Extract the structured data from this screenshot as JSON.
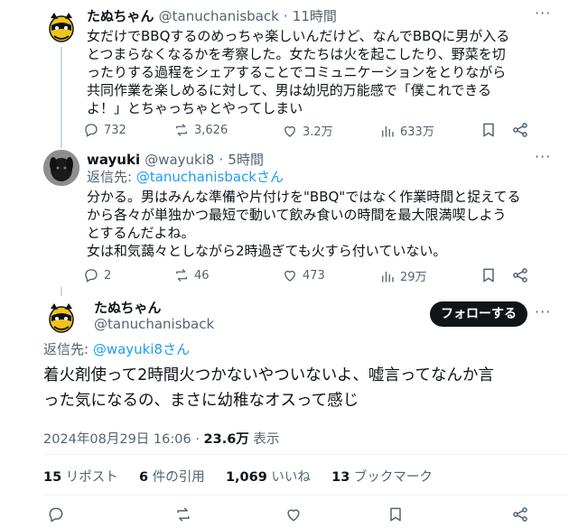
{
  "tweet1": {
    "name": "たぬちゃん",
    "handle": "@tanuchanisback",
    "time": "11時間",
    "lines": [
      "女だけでBBQするのめっちゃ楽しいんだけど、なんでBBQに男が入る",
      "とつまらなくなるかを考察した。女たちは火を起こしたり、野菜を切",
      "ったりする過程をシェアすることでコミュニケーションをとりながら",
      "共同作業を楽しめるに対して、男は幼児的万能感で「僕これできる",
      "よ！」とちゃっちゃとやってしまい"
    ],
    "replies": "732",
    "reposts": "3,626",
    "likes": "3.2万",
    "views": "633万"
  },
  "tweet2": {
    "name": "wayuki",
    "handle": "@wayuki8",
    "time": "5時間",
    "reply_prefix": "返信先: ",
    "reply_to": "@tanuchanisbackさん",
    "lines": [
      "分かる。男はみんな準備や片付けを\"BBQ\"ではなく作業時間と捉えてる",
      "から各々が単独かつ最短で動いて飲み食いの時間を最大限満喫しよう",
      "とするんだよね。",
      "女は和気藹々としながら2時過ぎても火すら付いていない。"
    ],
    "replies": "2",
    "reposts": "46",
    "likes": "473",
    "views": "29万"
  },
  "main": {
    "name": "たぬちゃん",
    "handle": "@tanuchanisback",
    "follow_label": "フォローする",
    "reply_prefix": "返信先: ",
    "reply_to": "@wayuki8さん",
    "lines": [
      "着火剤使って2時間火つかないやついないよ、嘘言ってなんか言",
      "った気になるの、まさに幼稚なオスって感じ"
    ],
    "timestamp": "2024年08月29日 16:06",
    "views_count": "23.6万",
    "views_label": " 表示",
    "reposts_count": "15",
    "reposts_label": " リポスト",
    "quotes_count": "6",
    "quotes_label": " 件の引用",
    "likes_count": "1,069",
    "likes_label": " いいね",
    "bookmarks_count": "13",
    "bookmarks_label": " ブックマーク"
  },
  "colors": {
    "link": "#1d9bf0",
    "muted": "#536471",
    "text": "#0f1419",
    "divider": "#eff3f4"
  }
}
